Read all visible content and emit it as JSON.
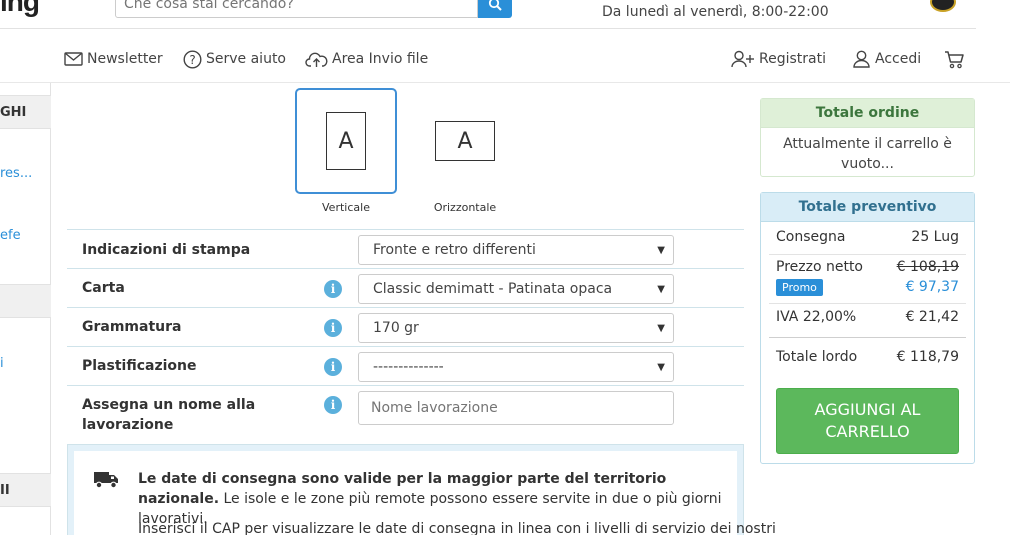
{
  "header": {
    "logo_text": "ing",
    "search_placeholder": "Che cosa stai cercando?",
    "hours": "Da lunedì al venerdì, 8:00-22:00"
  },
  "nav": {
    "newsletter": "Newsletter",
    "help": "Serve aiuto",
    "upload": "Area Invio file",
    "register": "Registrati",
    "login": "Accedi"
  },
  "sidebar": {
    "head_1": "GHI",
    "link_1": "res...",
    "link_2": "efe",
    "head_2": "",
    "link_3": "i",
    "head_3": "II"
  },
  "orientation": {
    "vertical_letter": "A",
    "vertical_label": "Verticale",
    "horizontal_letter": "A",
    "horizontal_label": "Orizzontale"
  },
  "form": {
    "print_label": "Indicazioni di stampa",
    "print_value": "Fronte e retro differenti",
    "paper_label": "Carta",
    "paper_value": "Classic demimatt - Patinata opaca",
    "weight_label": "Grammatura",
    "weight_value": "170 gr",
    "lamination_label": "Plastificazione",
    "lamination_value": "--------------",
    "name_label_1": "Assegna un nome alla",
    "name_label_2": "lavorazione",
    "name_placeholder": "Nome lavorazione",
    "info_glyph": "i"
  },
  "delivery": {
    "bold_text": "Le date di consegna sono valide per la maggior parte del territorio nazionale.",
    "rest_text": " Le isole e le zone più remote possono essere servite in due o più giorni lavorativi.",
    "second_text": "Inserisci il CAP per visualizzare le date di consegna in linea con i livelli di servizio dei nostri"
  },
  "order": {
    "title": "Totale ordine",
    "empty_text": "Attualmente il carrello è vuoto..."
  },
  "quote": {
    "title": "Totale preventivo",
    "delivery_label": "Consegna",
    "delivery_value": "25 Lug",
    "net_label": "Prezzo netto",
    "net_old": "€ 108,19",
    "promo_label": "Promo",
    "net_new": "€ 97,37",
    "vat_label": "IVA 22,00%",
    "vat_value": "€ 21,42",
    "gross_label": "Totale lordo",
    "gross_value": "€ 118,79",
    "cart_button": "AGGIUNGI AL CARRELLO"
  },
  "colors": {
    "accent": "#2a8fd8",
    "success": "#5cb85c",
    "info_bg": "#d9edf7"
  }
}
